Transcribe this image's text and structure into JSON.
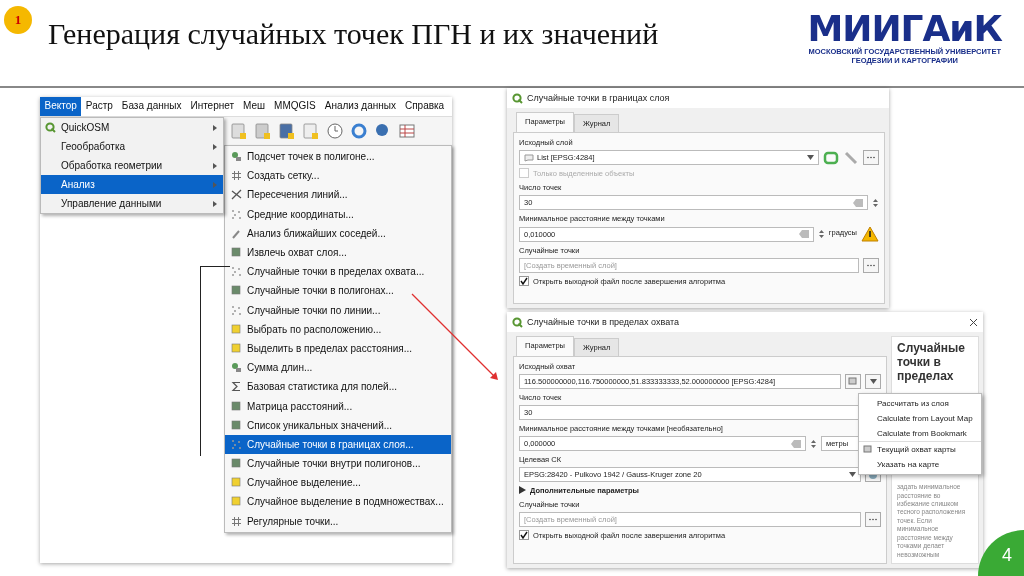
{
  "slide": {
    "badge": "1",
    "title": "Генерация случайных точек ПГН и их значений",
    "logo_name": "МИИГАиК",
    "logo_line_1": "МОСКОВСКИЙ ГОСУДАРСТВЕННЫЙ УНИВЕРСИТЕТ",
    "logo_line_2": "ГЕОДЕЗИИ И КАРТОГРАФИИ",
    "page_number": "4"
  },
  "menubar": [
    {
      "label": "Вектор",
      "selected": true
    },
    {
      "label": "Растр",
      "selected": false
    },
    {
      "label": "База данных",
      "selected": false
    },
    {
      "label": "Интернет",
      "selected": false
    },
    {
      "label": "Меш",
      "selected": false
    },
    {
      "label": "MMQGIS",
      "selected": false
    },
    {
      "label": "Анализ данных",
      "selected": false
    },
    {
      "label": "Справка",
      "selected": false
    }
  ],
  "vector_menu": [
    {
      "label": "QuickOSM",
      "selected": false
    },
    {
      "label": "Геообработка",
      "selected": false
    },
    {
      "label": "Обработка геометрии",
      "selected": false
    },
    {
      "label": "Анализ",
      "selected": true
    },
    {
      "label": "Управление данными",
      "selected": false
    }
  ],
  "analysis_menu": [
    {
      "label": "Подсчет точек в полигоне...",
      "selected": false
    },
    {
      "label": "Создать сетку...",
      "selected": false
    },
    {
      "label": "Пересечения линий...",
      "selected": false
    },
    {
      "label": "Средние координаты...",
      "selected": false
    },
    {
      "label": "Анализ ближайших соседей...",
      "selected": false
    },
    {
      "label": "Извлечь охват слоя...",
      "selected": false
    },
    {
      "label": "Случайные точки в пределах охвата...",
      "selected": false
    },
    {
      "label": "Случайные точки в полигонах...",
      "selected": false
    },
    {
      "label": "Случайные точки по линии...",
      "selected": false
    },
    {
      "label": "Выбрать по расположению...",
      "selected": false
    },
    {
      "label": "Выделить в пределах расстояния...",
      "selected": false
    },
    {
      "label": "Сумма длин...",
      "selected": false
    },
    {
      "label": "Базовая статистика для полей...",
      "selected": false
    },
    {
      "label": "Матрица расстояний...",
      "selected": false
    },
    {
      "label": "Список уникальных значений...",
      "selected": false
    },
    {
      "label": "Случайные точки в границах слоя...",
      "selected": true
    },
    {
      "label": "Случайные точки внутри полигонов...",
      "selected": false
    },
    {
      "label": "Случайное выделение...",
      "selected": false
    },
    {
      "label": "Случайное выделение в подмножествах...",
      "selected": false
    },
    {
      "label": "Регулярные точки...",
      "selected": false
    }
  ],
  "dialog_1": {
    "title": "Случайные точки в границах слоя",
    "tabs": [
      {
        "label": "Параметры",
        "selected": true
      },
      {
        "label": "Журнал",
        "selected": false
      }
    ],
    "source_label": "Исходный слой",
    "source_value": "List [EPSG:4284]",
    "selected_only": {
      "label": "Только выделенные объекты",
      "checked": false,
      "disabled": true
    },
    "points_label": "Число точек",
    "points_value": "30",
    "distance_label": "Минимальное расстояние между точками",
    "distance_value": "0,010000",
    "units": "градусы",
    "output_label": "Случайные точки",
    "output_placeholder": "[Создать временный слой]",
    "open_output": {
      "label": "Открыть выходной файл после завершения алгоритма",
      "checked": true
    }
  },
  "dialog_2": {
    "title": "Случайные точки в пределах охвата",
    "tabs": [
      {
        "label": "Параметры",
        "selected": true
      },
      {
        "label": "Журнал",
        "selected": false
      }
    ],
    "extent_label": "Исходный охват",
    "extent_value": "116.500000000,116.750000000,51.833333333,52.000000000 [EPSG:4284]",
    "points_label": "Число точек",
    "points_value": "30",
    "distance_label": "Минимальное расстояние между точками [необязательно]",
    "distance_value": "0,000000",
    "units": "метры",
    "crs_label": "Целевая СК",
    "crs_value": "EPSG:28420 - Pulkovo 1942 / Gauss-Kruger zone 20",
    "advanced_label": "Дополнительные параметры",
    "output_label": "Случайные точки",
    "output_placeholder": "[Создать временный слой]",
    "open_output": {
      "label": "Открыть выходной файл после завершения алгоритма",
      "checked": true
    },
    "help_title": "Случайные точки в пределах",
    "help_text": "задать минимальное расстояние во избежание слишком тесного расположения точек. Если минимальное расстояние между точками делает невозможным",
    "extent_menu": [
      {
        "label": "Рассчитать из слоя",
        "kind": "text"
      },
      {
        "label": "Calculate from Layout Map",
        "kind": "text"
      },
      {
        "label": "Calculate from Bookmark",
        "kind": "text"
      },
      {
        "label": "Текущий охват карты",
        "kind": "icon"
      },
      {
        "label": "Указать на карте",
        "kind": "text"
      }
    ]
  }
}
